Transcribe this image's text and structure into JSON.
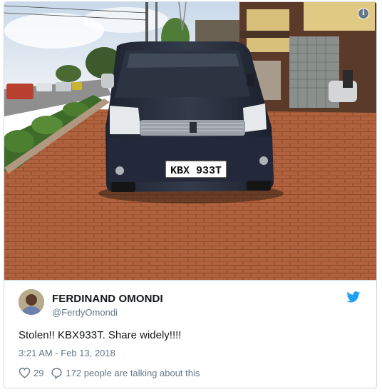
{
  "photo": {
    "plate": "KBX 933T"
  },
  "tweet": {
    "display_name": "FERDINAND OMONDI",
    "handle": "@FerdyOmondi",
    "text": "Stolen!! KBX933T. Share widely!!!!",
    "timestamp": "3:21 AM - Feb 13, 2018",
    "likes": "29",
    "conversation": "172 people are talking about this"
  },
  "icons": {
    "info": "info-icon",
    "bird": "twitter-bird-icon",
    "heart": "heart-icon",
    "reply": "reply-bubble-icon"
  },
  "colors": {
    "brand_blue": "#1da1f2",
    "secondary_text": "#657786",
    "border": "#cfd9de"
  }
}
